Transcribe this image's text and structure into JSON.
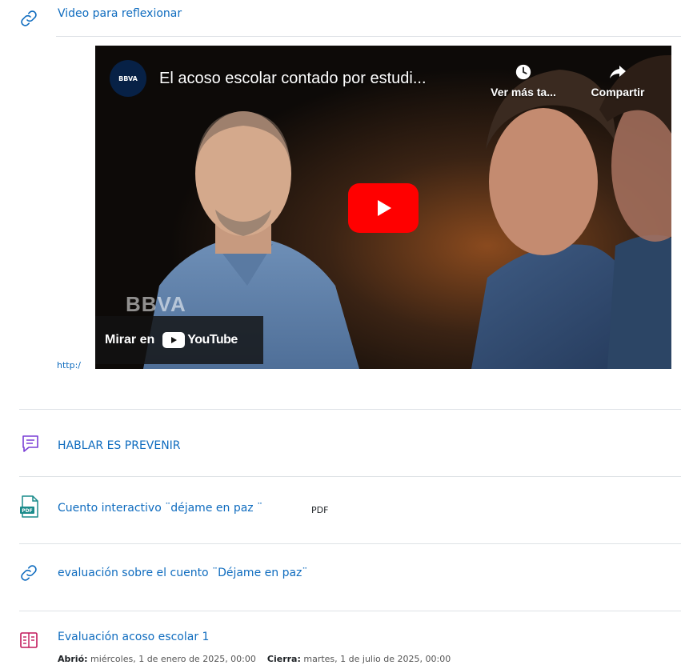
{
  "top_link": {
    "label": "Video para reflexionar"
  },
  "video": {
    "title": "El acoso escolar contado por estudi...",
    "channel_logo_text": "BBVA",
    "watch_later": "Ver más ta...",
    "share": "Compartir",
    "watch_on": "Mirar en",
    "youtube": "YouTube",
    "watermark": "BBVA"
  },
  "url_fragment": "http:/",
  "activities": [
    {
      "label": "HABLAR ES PREVENIR"
    },
    {
      "label": "Cuento interactivo ¨déjame en paz ¨",
      "type": "PDF"
    },
    {
      "label": "evaluación sobre el cuento ¨Déjame en paz¨"
    },
    {
      "label": "Evaluación acoso escolar 1",
      "opened_label": "Abrió:",
      "opened_value": "miércoles, 1 de enero de 2025, 00:00",
      "closes_label": "Cierra:",
      "closes_value": "martes, 1 de julio de 2025, 00:00"
    }
  ],
  "colors": {
    "link": "#0f6cbf",
    "icon_link": "#0f6cbf",
    "icon_page": "#7a3ed6",
    "icon_pdf": "#1a8b8b",
    "icon_quiz": "#c2185b",
    "yt_red": "#ff0000"
  }
}
